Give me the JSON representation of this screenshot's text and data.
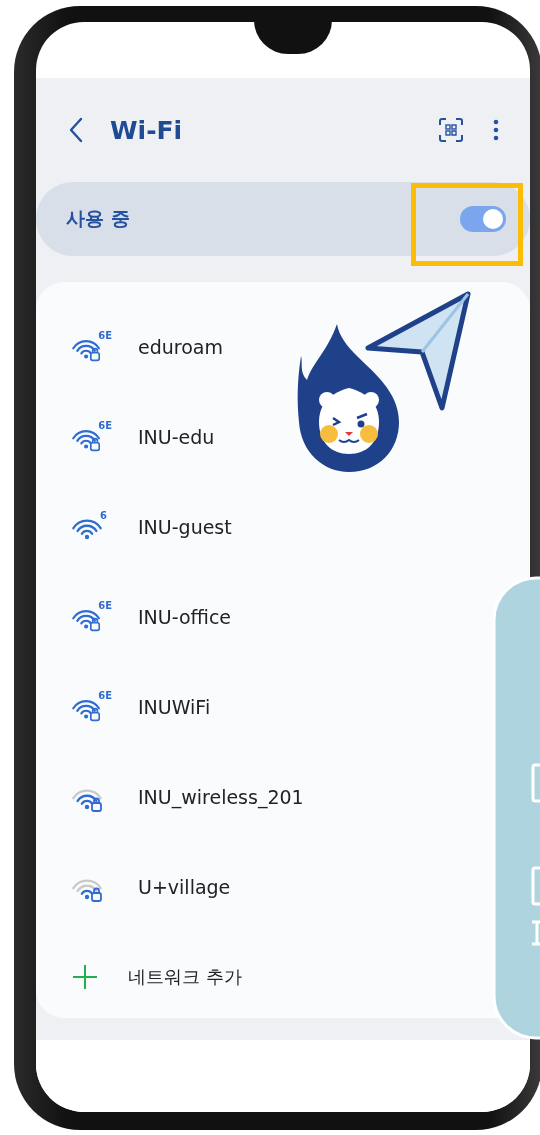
{
  "header": {
    "title": "Wi-Fi"
  },
  "wifi_toggle": {
    "label": "사용 중",
    "on": true
  },
  "networks": [
    {
      "name": "eduroam",
      "band": "6E",
      "secured": true,
      "kind": "full"
    },
    {
      "name": "INU-edu",
      "band": "6E",
      "secured": true,
      "kind": "full"
    },
    {
      "name": "INU-guest",
      "band": "6",
      "secured": false,
      "kind": "full"
    },
    {
      "name": "INU-office",
      "band": "6E",
      "secured": true,
      "kind": "full"
    },
    {
      "name": "INUWiFi",
      "band": "6E",
      "secured": true,
      "kind": "full"
    },
    {
      "name": "INU_wireless_201",
      "secured": true,
      "kind": "good"
    },
    {
      "name": "U+village",
      "secured": true,
      "kind": "fair"
    }
  ],
  "add_network": {
    "label": "네트워크 추가"
  }
}
